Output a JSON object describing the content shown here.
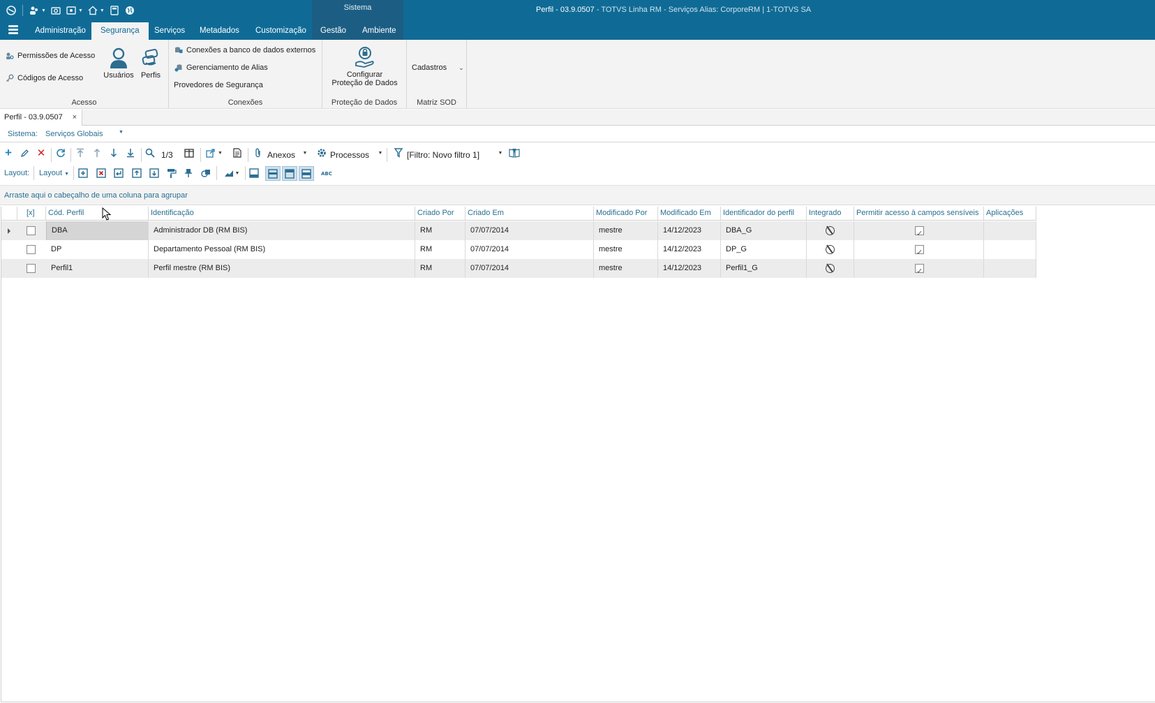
{
  "window": {
    "title_main": "Perfil - 03.9.0507",
    "title_suffix": " - TOTVS Linha RM - Serviços  Alias: CorporeRM | 1-TOTVS SA",
    "context_group": "Sistema"
  },
  "tabs": {
    "administracao": "Administração",
    "seguranca": "Segurança",
    "servicos": "Serviços",
    "metadados": "Metadados",
    "customizacao": "Customização",
    "gestao": "Gestão",
    "ambiente": "Ambiente",
    "active": "Segurança"
  },
  "ribbon": {
    "acesso": {
      "label": "Acesso",
      "permissoes": "Permissões de Acesso",
      "codigos": "Códigos de Acesso",
      "usuarios": "Usuários",
      "perfis": "Perfis"
    },
    "conexoes": {
      "label": "Conexões",
      "bancos_externos": "Conexões a banco de dados externos",
      "alias": "Gerenciamento de Alias",
      "provedores": "Provedores de Segurança"
    },
    "protecao": {
      "label": "Proteção de Dados",
      "configurar_l1": "Configurar",
      "configurar_l2": "Proteção de Dados"
    },
    "matriz": {
      "label": "Matriz SOD",
      "cadastros": "Cadastros"
    }
  },
  "doc_tab": {
    "label": "Perfil - 03.9.0507",
    "close": "×"
  },
  "sistema": {
    "label": "Sistema:",
    "value": "Serviços Globais"
  },
  "toolbar": {
    "paging": "1/3",
    "anexos": "Anexos",
    "processos": "Processos",
    "filtro": "[Filtro: Novo filtro 1]",
    "layout_label": "Layout:",
    "layout_menu": "Layout"
  },
  "group_panel": "Arraste aqui o cabeçalho de uma coluna para agrupar",
  "grid": {
    "headers": {
      "select": "[x]",
      "cod": "Cód. Perfil",
      "ident": "Identificação",
      "criado_por": "Criado Por",
      "criado_em": "Criado Em",
      "modificado_por": "Modificado Por",
      "modificado_em": "Modificado Em",
      "identificador": "Identificador do perfil",
      "integrado": "Integrado",
      "permitir": "Permitir acesso à campos sensíveis",
      "aplicacoes": "Aplicações"
    },
    "rows": [
      {
        "cod": "DBA",
        "ident": "Administrador DB (RM BIS)",
        "criado_por": "RM",
        "criado_em": "07/07/2014",
        "modificado_por": "mestre",
        "modificado_em": "14/12/2023",
        "identificador": "DBA_G",
        "selected": false,
        "permitir": true,
        "aplicacoes": ""
      },
      {
        "cod": "DP",
        "ident": "Departamento Pessoal (RM BIS)",
        "criado_por": "RM",
        "criado_em": "07/07/2014",
        "modificado_por": "mestre",
        "modificado_em": "14/12/2023",
        "identificador": "DP_G",
        "selected": false,
        "permitir": true,
        "aplicacoes": ""
      },
      {
        "cod": "Perfil1",
        "ident": "Perfil mestre (RM BIS)",
        "criado_por": "RM",
        "criado_em": "07/07/2014",
        "modificado_por": "mestre",
        "modificado_em": "14/12/2023",
        "identificador": "Perfil1_G",
        "selected": false,
        "permitir": true,
        "aplicacoes": ""
      }
    ]
  },
  "colors": {
    "title_bar": "#0f6b96",
    "context_group": "#1c5e83",
    "ribbon_bg": "#f3f3f3",
    "link_text": "#2a6f92",
    "alt_row": "#ececec"
  }
}
